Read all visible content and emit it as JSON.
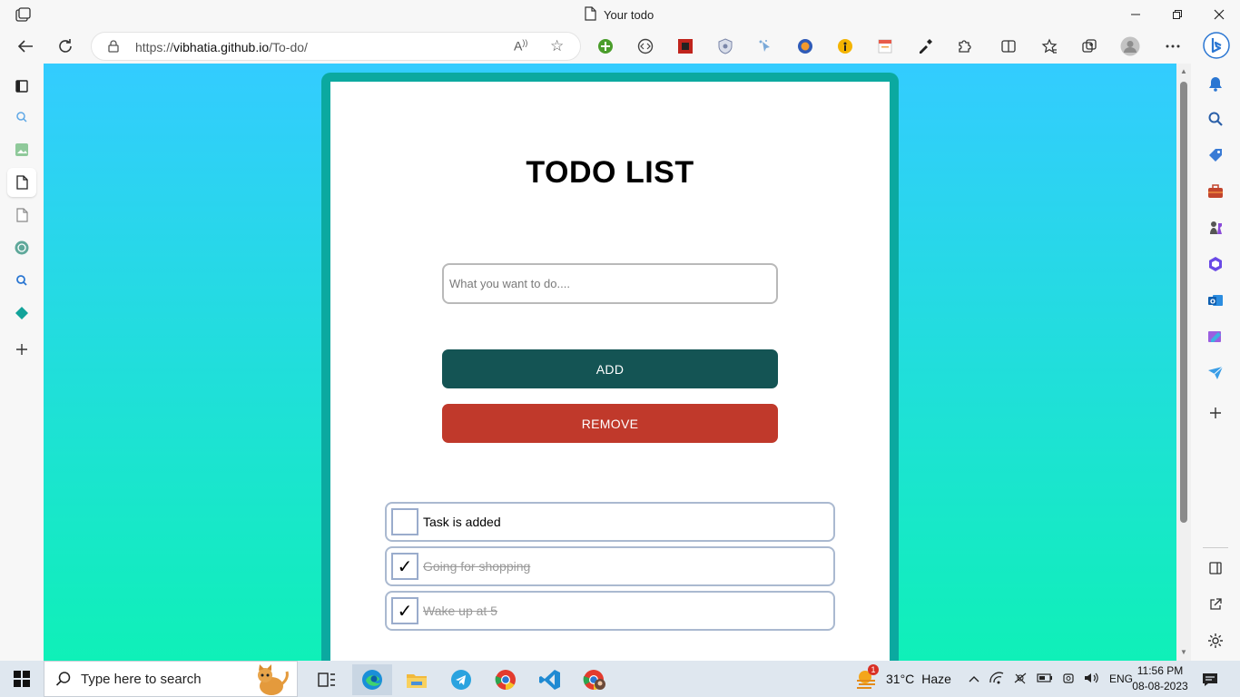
{
  "window": {
    "tab_title": "Your todo"
  },
  "address_bar": {
    "url_prefix": "https://",
    "url_host": "vibhatia.github.io",
    "url_path": "/To-do/",
    "read_aloud_label": "A̒"
  },
  "todo": {
    "title": "TODO LIST",
    "input_placeholder": "What you want to do....",
    "input_value": "",
    "add_label": "ADD",
    "remove_label": "REMOVE",
    "items": [
      {
        "text": "Task is added",
        "checked": false,
        "check_mark": ""
      },
      {
        "text": "Going for shopping",
        "checked": true,
        "check_mark": "✓"
      },
      {
        "text": "Wake up at 5",
        "checked": true,
        "check_mark": "✓"
      }
    ]
  },
  "taskbar": {
    "search_placeholder": "Type here to search",
    "weather_temp": "31°C",
    "weather_desc": "Haze",
    "weather_badge": "1",
    "language": "ENG",
    "time": "11:56 PM",
    "date": "08-08-2023"
  },
  "colors": {
    "bg_top": "#33ccff",
    "bg_bottom": "#0ff0b8",
    "card_border": "#0ba9a0",
    "add_button": "#145454",
    "remove_button": "#c0392b"
  }
}
